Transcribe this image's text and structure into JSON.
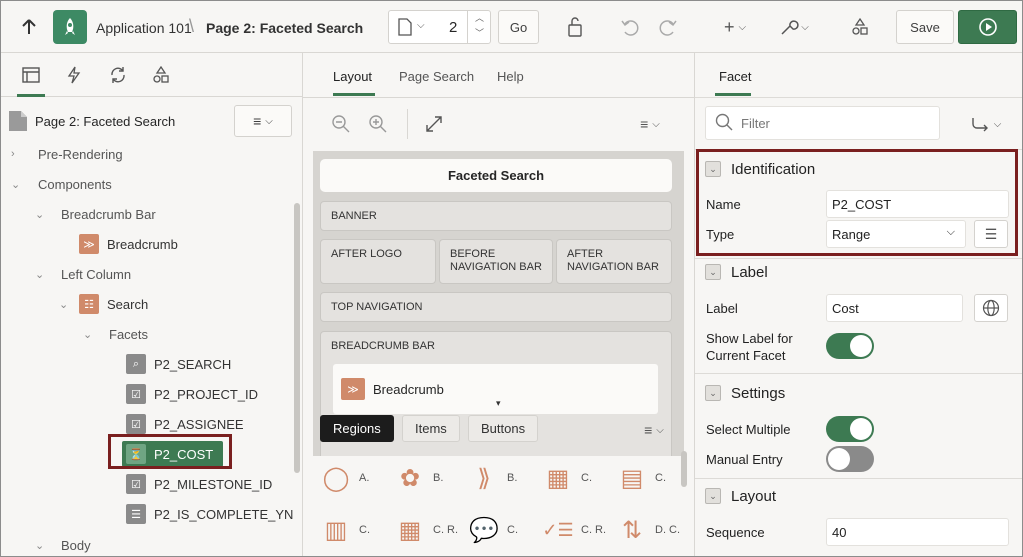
{
  "toolbar": {
    "app_name": "Application 101",
    "page_title": "Page 2: Faceted Search",
    "page_number": "2",
    "go_label": "Go",
    "save_label": "Save"
  },
  "left": {
    "tree_root": "Page 2: Faceted Search",
    "nodes": {
      "pre_rendering": "Pre-Rendering",
      "components": "Components",
      "breadcrumb_bar": "Breadcrumb Bar",
      "breadcrumb": "Breadcrumb",
      "left_column": "Left Column",
      "search": "Search",
      "facets": "Facets",
      "p2_search": "P2_SEARCH",
      "p2_project_id": "P2_PROJECT_ID",
      "p2_assignee": "P2_ASSIGNEE",
      "p2_cost": "P2_COST",
      "p2_milestone_id": "P2_MILESTONE_ID",
      "p2_is_complete_yn": "P2_IS_COMPLETE_YN",
      "body": "Body"
    }
  },
  "middle": {
    "tabs": [
      "Layout",
      "Page Search",
      "Help"
    ],
    "layout": {
      "title": "Faceted Search",
      "banner": "BANNER",
      "after_logo": "AFTER LOGO",
      "before_nav": "BEFORE NAVIGATION BAR",
      "after_nav": "AFTER NAVIGATION BAR",
      "top_nav": "TOP NAVIGATION",
      "breadcrumb_bar": "BREADCRUMB BAR",
      "breadcrumb": "Breadcrumb"
    },
    "gallery_tabs": [
      "Regions",
      "Items",
      "Buttons"
    ],
    "gallery_items": [
      "A.",
      "B.",
      "B.",
      "C.",
      "C.",
      "C.",
      "C. R.",
      "C.",
      "C. R.",
      "D. C."
    ]
  },
  "right": {
    "tab": "Facet",
    "filter_placeholder": "Filter",
    "sections": {
      "identification": "Identification",
      "label": "Label",
      "settings": "Settings",
      "layout": "Layout"
    },
    "props": {
      "name_label": "Name",
      "name_value": "P2_COST",
      "type_label": "Type",
      "type_value": "Range",
      "label_label": "Label",
      "label_value": "Cost",
      "show_label": "Show Label for Current Facet",
      "select_multiple": "Select Multiple",
      "manual_entry": "Manual Entry",
      "sequence_label": "Sequence",
      "sequence_value": "40"
    },
    "toggles": {
      "show_label": true,
      "select_multiple": true,
      "manual_entry": false
    }
  },
  "colors": {
    "accent": "#3d7a52",
    "highlight_border": "#7a1f1f",
    "icon_orange": "#d08a6a"
  }
}
